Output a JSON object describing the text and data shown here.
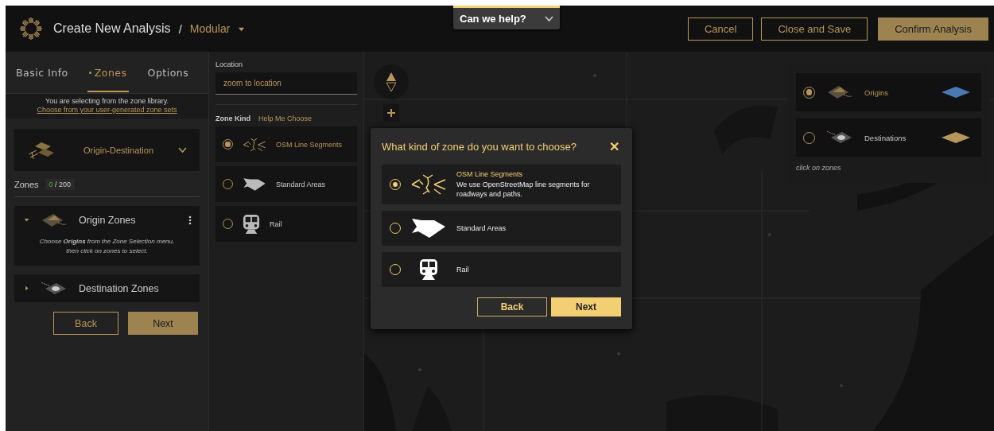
{
  "header": {
    "title": "Create New Analysis",
    "separator": "/",
    "mode": "Modular",
    "buttons": [
      {
        "label": "Cancel",
        "kind": "outline"
      },
      {
        "label": "Close and Save",
        "kind": "outline"
      },
      {
        "label": "Confirm Analysis",
        "kind": "filled"
      }
    ]
  },
  "help": {
    "label": "Can we help?"
  },
  "tabs": [
    {
      "label": "Basic Info",
      "selected": false
    },
    {
      "label": "Zones",
      "selected": true
    },
    {
      "label": "Options",
      "selected": false
    }
  ],
  "library_note": {
    "text": "You are selecting from the zone library.",
    "link": "Choose from your user-generated zone sets"
  },
  "analysis_type": {
    "label": "Origin-Destination"
  },
  "zones_count": {
    "label": "Zones",
    "count": "0",
    "total": "/ 200"
  },
  "zone_groups": [
    {
      "label": "Origin Zones",
      "expanded": true,
      "hint": "Choose **Origins** from the Zone Selection menu, then click on zones to select."
    },
    {
      "label": "Destination Zones",
      "expanded": false
    }
  ],
  "left_buttons": [
    {
      "label": "Back",
      "kind": "outline"
    },
    {
      "label": "Next",
      "kind": "filled"
    }
  ],
  "location": {
    "label": "Location",
    "placeholder": "zoom to location"
  },
  "zone_kind": {
    "label": "Zone Kind",
    "help": "Help Me Choose",
    "options": [
      {
        "label": "OSM Line Segments",
        "selected": true,
        "kind": "lines"
      },
      {
        "label": "Standard Areas",
        "selected": false,
        "kind": "area"
      },
      {
        "label": "Rail",
        "selected": false,
        "kind": "rail"
      }
    ]
  },
  "dialog": {
    "title": "What kind of zone do you want to choose?",
    "close": "✕",
    "options": [
      {
        "label": "OSM Line Segments",
        "description": "We use OpenStreetMap line segments for roadways and paths.",
        "selected": true,
        "kind": "lines"
      },
      {
        "label": "Standard Areas",
        "selected": false,
        "kind": "area"
      },
      {
        "label": "Rail",
        "selected": false,
        "kind": "rail"
      }
    ],
    "buttons": [
      {
        "label": "Back",
        "kind": "outline"
      },
      {
        "label": "Next",
        "kind": "bright"
      }
    ]
  },
  "legend": {
    "items": [
      {
        "label": "Origins",
        "selected": true,
        "color": "#4a78b4",
        "kind": "origin"
      },
      {
        "label": "Destinations",
        "selected": false,
        "color": "#b8965a",
        "kind": "destination"
      }
    ],
    "hint": "click on zones"
  }
}
